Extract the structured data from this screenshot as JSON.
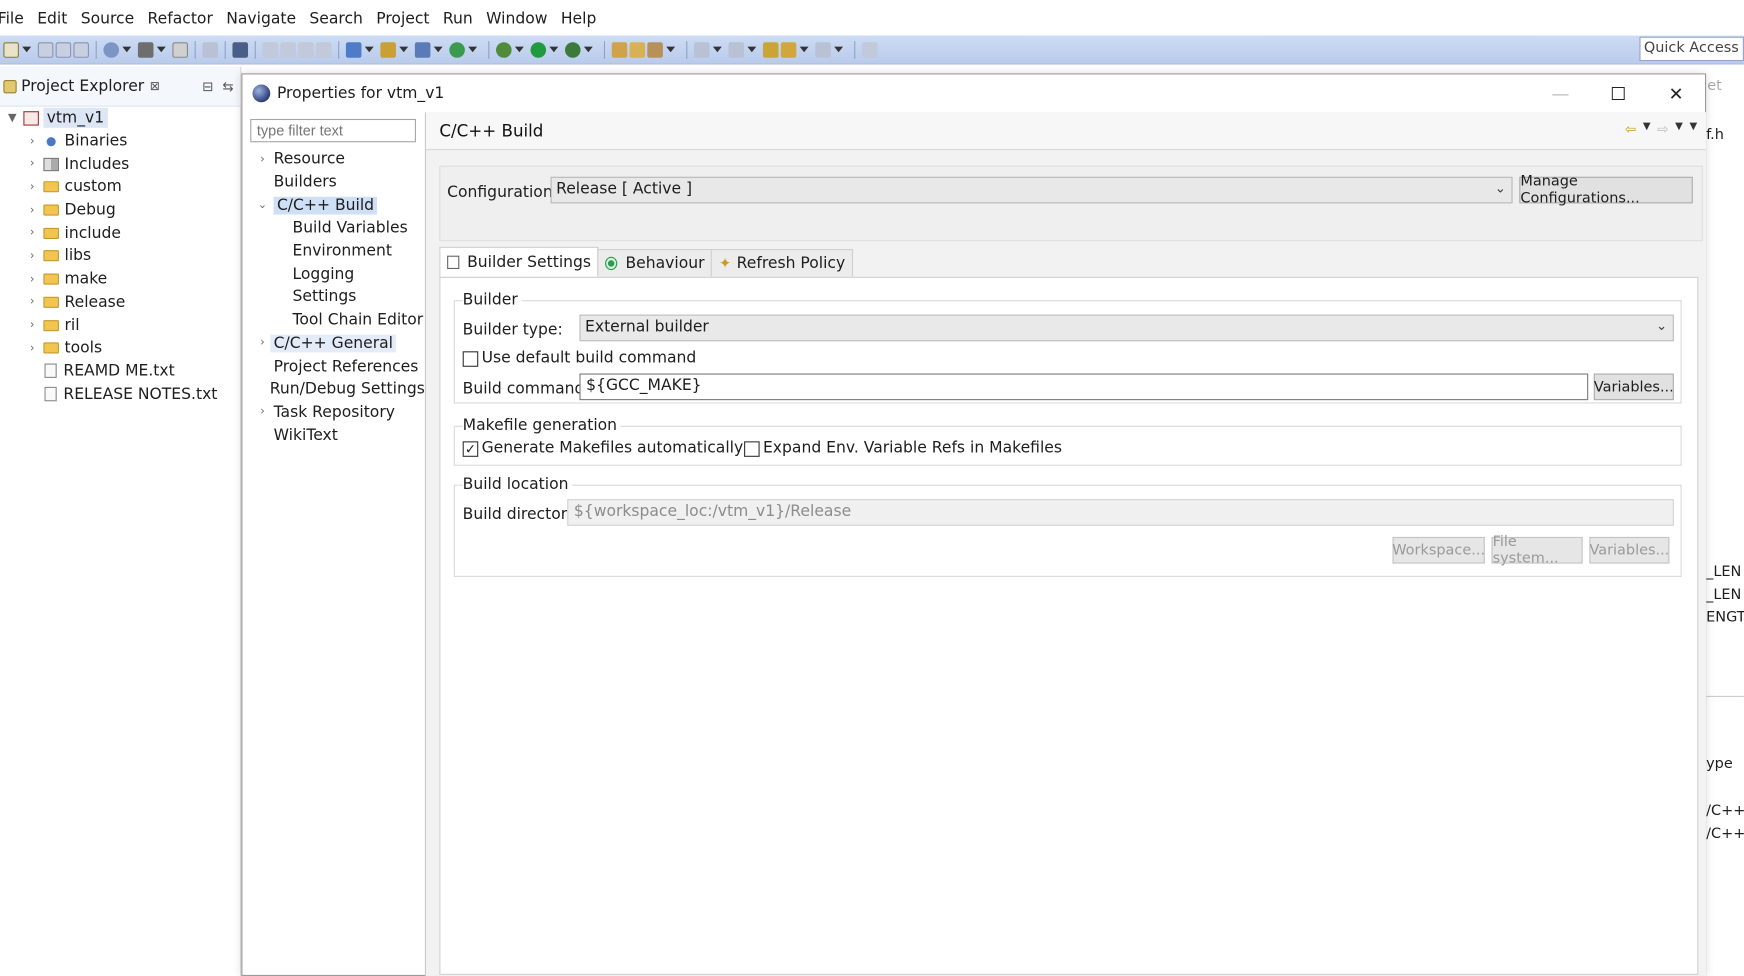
{
  "menubar": [
    "File",
    "Edit",
    "Source",
    "Refactor",
    "Navigate",
    "Search",
    "Project",
    "Run",
    "Window",
    "Help"
  ],
  "toolbar": {
    "quick_access": "Quick Access"
  },
  "project_explorer": {
    "title": "Project Explorer",
    "close": "⊠",
    "root": "vtm_v1",
    "items": [
      {
        "label": "Binaries",
        "kind": "bin"
      },
      {
        "label": "Includes",
        "kind": "inc"
      },
      {
        "label": "custom",
        "kind": "folder"
      },
      {
        "label": "Debug",
        "kind": "folder"
      },
      {
        "label": "include",
        "kind": "folder"
      },
      {
        "label": "libs",
        "kind": "folder"
      },
      {
        "label": "make",
        "kind": "folder"
      },
      {
        "label": "Release",
        "kind": "folder"
      },
      {
        "label": "ril",
        "kind": "folder"
      },
      {
        "label": "tools",
        "kind": "folder"
      },
      {
        "label": "REAMD ME.txt",
        "kind": "file"
      },
      {
        "label": "RELEASE NOTES.txt",
        "kind": "file"
      }
    ]
  },
  "right_fragment": {
    "top": "et",
    "fh": "f.h",
    "len1": "_LEN",
    "len2": "_LEN",
    "ength": "ENGTH",
    "ype": "ype",
    "c1": "/C++",
    "c2": "/C++"
  },
  "dialog": {
    "title": "Properties for vtm_v1",
    "filter_placeholder": "type filter text",
    "nav": {
      "resource": "Resource",
      "builders": "Builders",
      "cbuild": "C/C++ Build",
      "build_variables": "Build Variables",
      "environment": "Environment",
      "logging": "Logging",
      "settings": "Settings",
      "tool_chain_editor": "Tool Chain Editor",
      "cgeneral": "C/C++ General",
      "project_references": "Project References",
      "run_debug": "Run/Debug Settings",
      "task_repository": "Task Repository",
      "wikitext": "WikiText"
    },
    "page_title": "C/C++ Build",
    "configuration_label": "Configuration:",
    "configuration_value": "Release  [ Active ]",
    "manage_configurations": "Manage Configurations...",
    "tabs": {
      "builder_settings": "Builder Settings",
      "behaviour": "Behaviour",
      "refresh_policy": "Refresh Policy"
    },
    "builder": {
      "group": "Builder",
      "type_label": "Builder type:",
      "type_value": "External builder",
      "use_default": "Use default build command",
      "command_label": "Build command:",
      "command_value": "${GCC_MAKE}",
      "variables": "Variables..."
    },
    "makefile": {
      "group": "Makefile generation",
      "generate": "Generate Makefiles automatically",
      "expand": "Expand Env. Variable Refs in Makefiles"
    },
    "location": {
      "group": "Build location",
      "dir_label": "Build directory:",
      "dir_value": "${workspace_loc:/vtm_v1}/Release",
      "workspace": "Workspace...",
      "file_system": "File system...",
      "variables": "Variables..."
    }
  }
}
